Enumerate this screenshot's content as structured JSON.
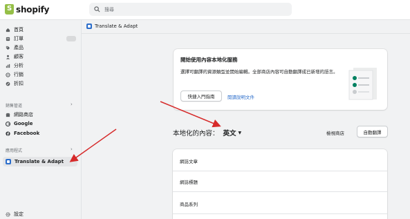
{
  "brand": {
    "name": "shopify"
  },
  "search": {
    "placeholder": "搜尋"
  },
  "sidebar": {
    "items": [
      {
        "label": "首頁",
        "icon": "home-icon"
      },
      {
        "label": "訂單",
        "icon": "orders-icon"
      },
      {
        "label": "產品",
        "icon": "tag-icon"
      },
      {
        "label": "顧客",
        "icon": "person-icon"
      },
      {
        "label": "分析",
        "icon": "chart-icon"
      },
      {
        "label": "行銷",
        "icon": "target-icon"
      },
      {
        "label": "折扣",
        "icon": "discount-icon"
      }
    ],
    "sales_channels_label": "銷售管道",
    "channels": [
      {
        "label": "網路商店",
        "icon": "store-icon"
      },
      {
        "label": "Google",
        "icon": "google-icon"
      },
      {
        "label": "Facebook",
        "icon": "facebook-icon"
      }
    ],
    "apps_label": "應用程式",
    "active_app": "Translate & Adapt",
    "settings_label": "設定"
  },
  "breadcrumb": {
    "app": "Translate & Adapt"
  },
  "onboarding": {
    "title": "開始使用內容本地化服務",
    "description": "選擇可翻譯的資源類型並開始編輯。全部商店內容可自動翻譯成已新增的語言。",
    "guide_button": "快捷入門指南",
    "docs_link": "閱讀說明文件"
  },
  "localize": {
    "label": "本地化的內容：",
    "language": "英文",
    "view_store": "檢視商店",
    "auto_translate": "自動翻譯"
  },
  "resources": [
    "網誌文章",
    "網誌標題",
    "商品系列"
  ],
  "colors": {
    "accent": "#2c6ecb",
    "annotation_arrow": "#d62a2a",
    "brand_green": "#95bf47"
  }
}
